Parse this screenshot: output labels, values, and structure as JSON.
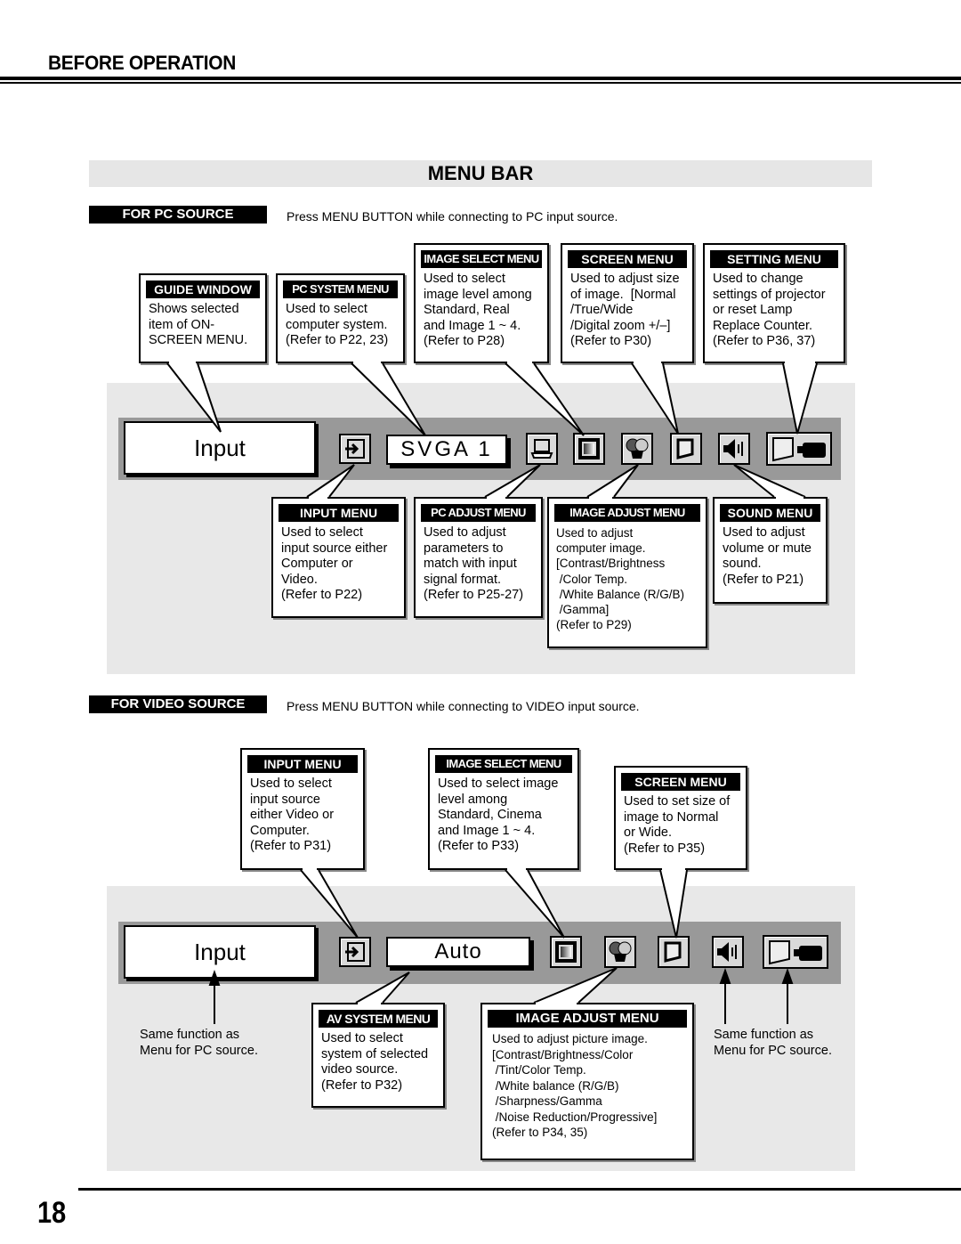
{
  "header": {
    "section_title": "BEFORE OPERATION",
    "menu_bar_title": "MENU BAR"
  },
  "pc_source": {
    "label": "FOR PC SOURCE",
    "description": "Press MENU BUTTON while connecting to PC input source.",
    "menu_bar": {
      "guide_text": "Input",
      "system_text": "SVGA 1"
    },
    "callouts": {
      "guide_window": {
        "title": "GUIDE WINDOW",
        "body": "Shows selected\nitem of ON-\nSCREEN MENU."
      },
      "pc_system_menu": {
        "title": "PC SYSTEM MENU",
        "body": "Used to select\ncomputer system.\n(Refer to P22, 23)"
      },
      "image_select_menu": {
        "title": "IMAGE SELECT MENU",
        "body": "Used to select\nimage level among\nStandard, Real\nand Image 1 ~ 4.\n(Refer to P28)"
      },
      "screen_menu": {
        "title": "SCREEN MENU",
        "body": "Used to adjust size\nof image.  [Normal\n/True/Wide\n/Digital zoom +/–]\n(Refer to P30)"
      },
      "setting_menu": {
        "title": "SETTING MENU",
        "body": "Used to change\nsettings of projector\nor reset Lamp\nReplace Counter.\n(Refer to P36, 37)"
      },
      "input_menu": {
        "title": "INPUT MENU",
        "body": "Used to select\ninput source either\nComputer or\nVideo.\n(Refer to P22)"
      },
      "pc_adjust_menu": {
        "title": "PC ADJUST MENU",
        "body": "Used to adjust\nparameters to\nmatch with input\nsignal format.\n(Refer to P25-27)"
      },
      "image_adjust_menu": {
        "title": "IMAGE ADJUST MENU",
        "body": "Used to adjust\ncomputer image.\n[Contrast/Brightness\n /Color Temp.\n /White Balance (R/G/B)\n /Gamma]\n(Refer to P29)"
      },
      "sound_menu": {
        "title": "SOUND MENU",
        "body": "Used to adjust\nvolume or mute\nsound.\n(Refer to P21)"
      }
    }
  },
  "video_source": {
    "label": "FOR VIDEO SOURCE",
    "description": "Press MENU BUTTON while connecting to VIDEO input source.",
    "menu_bar": {
      "guide_text": "Input",
      "system_text": "Auto"
    },
    "callouts": {
      "input_menu": {
        "title": "INPUT MENU",
        "body": "Used to select\ninput source\neither Video or\nComputer.\n(Refer to P31)"
      },
      "image_select_menu": {
        "title": "IMAGE SELECT MENU",
        "body": "Used to select image\nlevel among\nStandard, Cinema\nand Image 1 ~ 4.\n(Refer to P33)"
      },
      "screen_menu": {
        "title": "SCREEN MENU",
        "body": "Used to set size of\nimage to Normal\nor Wide.\n(Refer to P35)"
      },
      "av_system_menu": {
        "title": "AV SYSTEM MENU",
        "body": "Used to select\nsystem of selected\nvideo source.\n(Refer to P32)"
      },
      "image_adjust_menu": {
        "title": "IMAGE ADJUST MENU",
        "body": "Used to adjust picture image.\n[Contrast/Brightness/Color\n /Tint/Color Temp.\n /White balance (R/G/B)\n /Sharpness/Gamma\n /Noise Reduction/Progressive]\n(Refer to P34, 35)"
      }
    },
    "notes": {
      "left": "Same function as\nMenu for PC source.",
      "right": "Same function as\nMenu for PC source."
    }
  },
  "footer": {
    "page_number": "18"
  }
}
